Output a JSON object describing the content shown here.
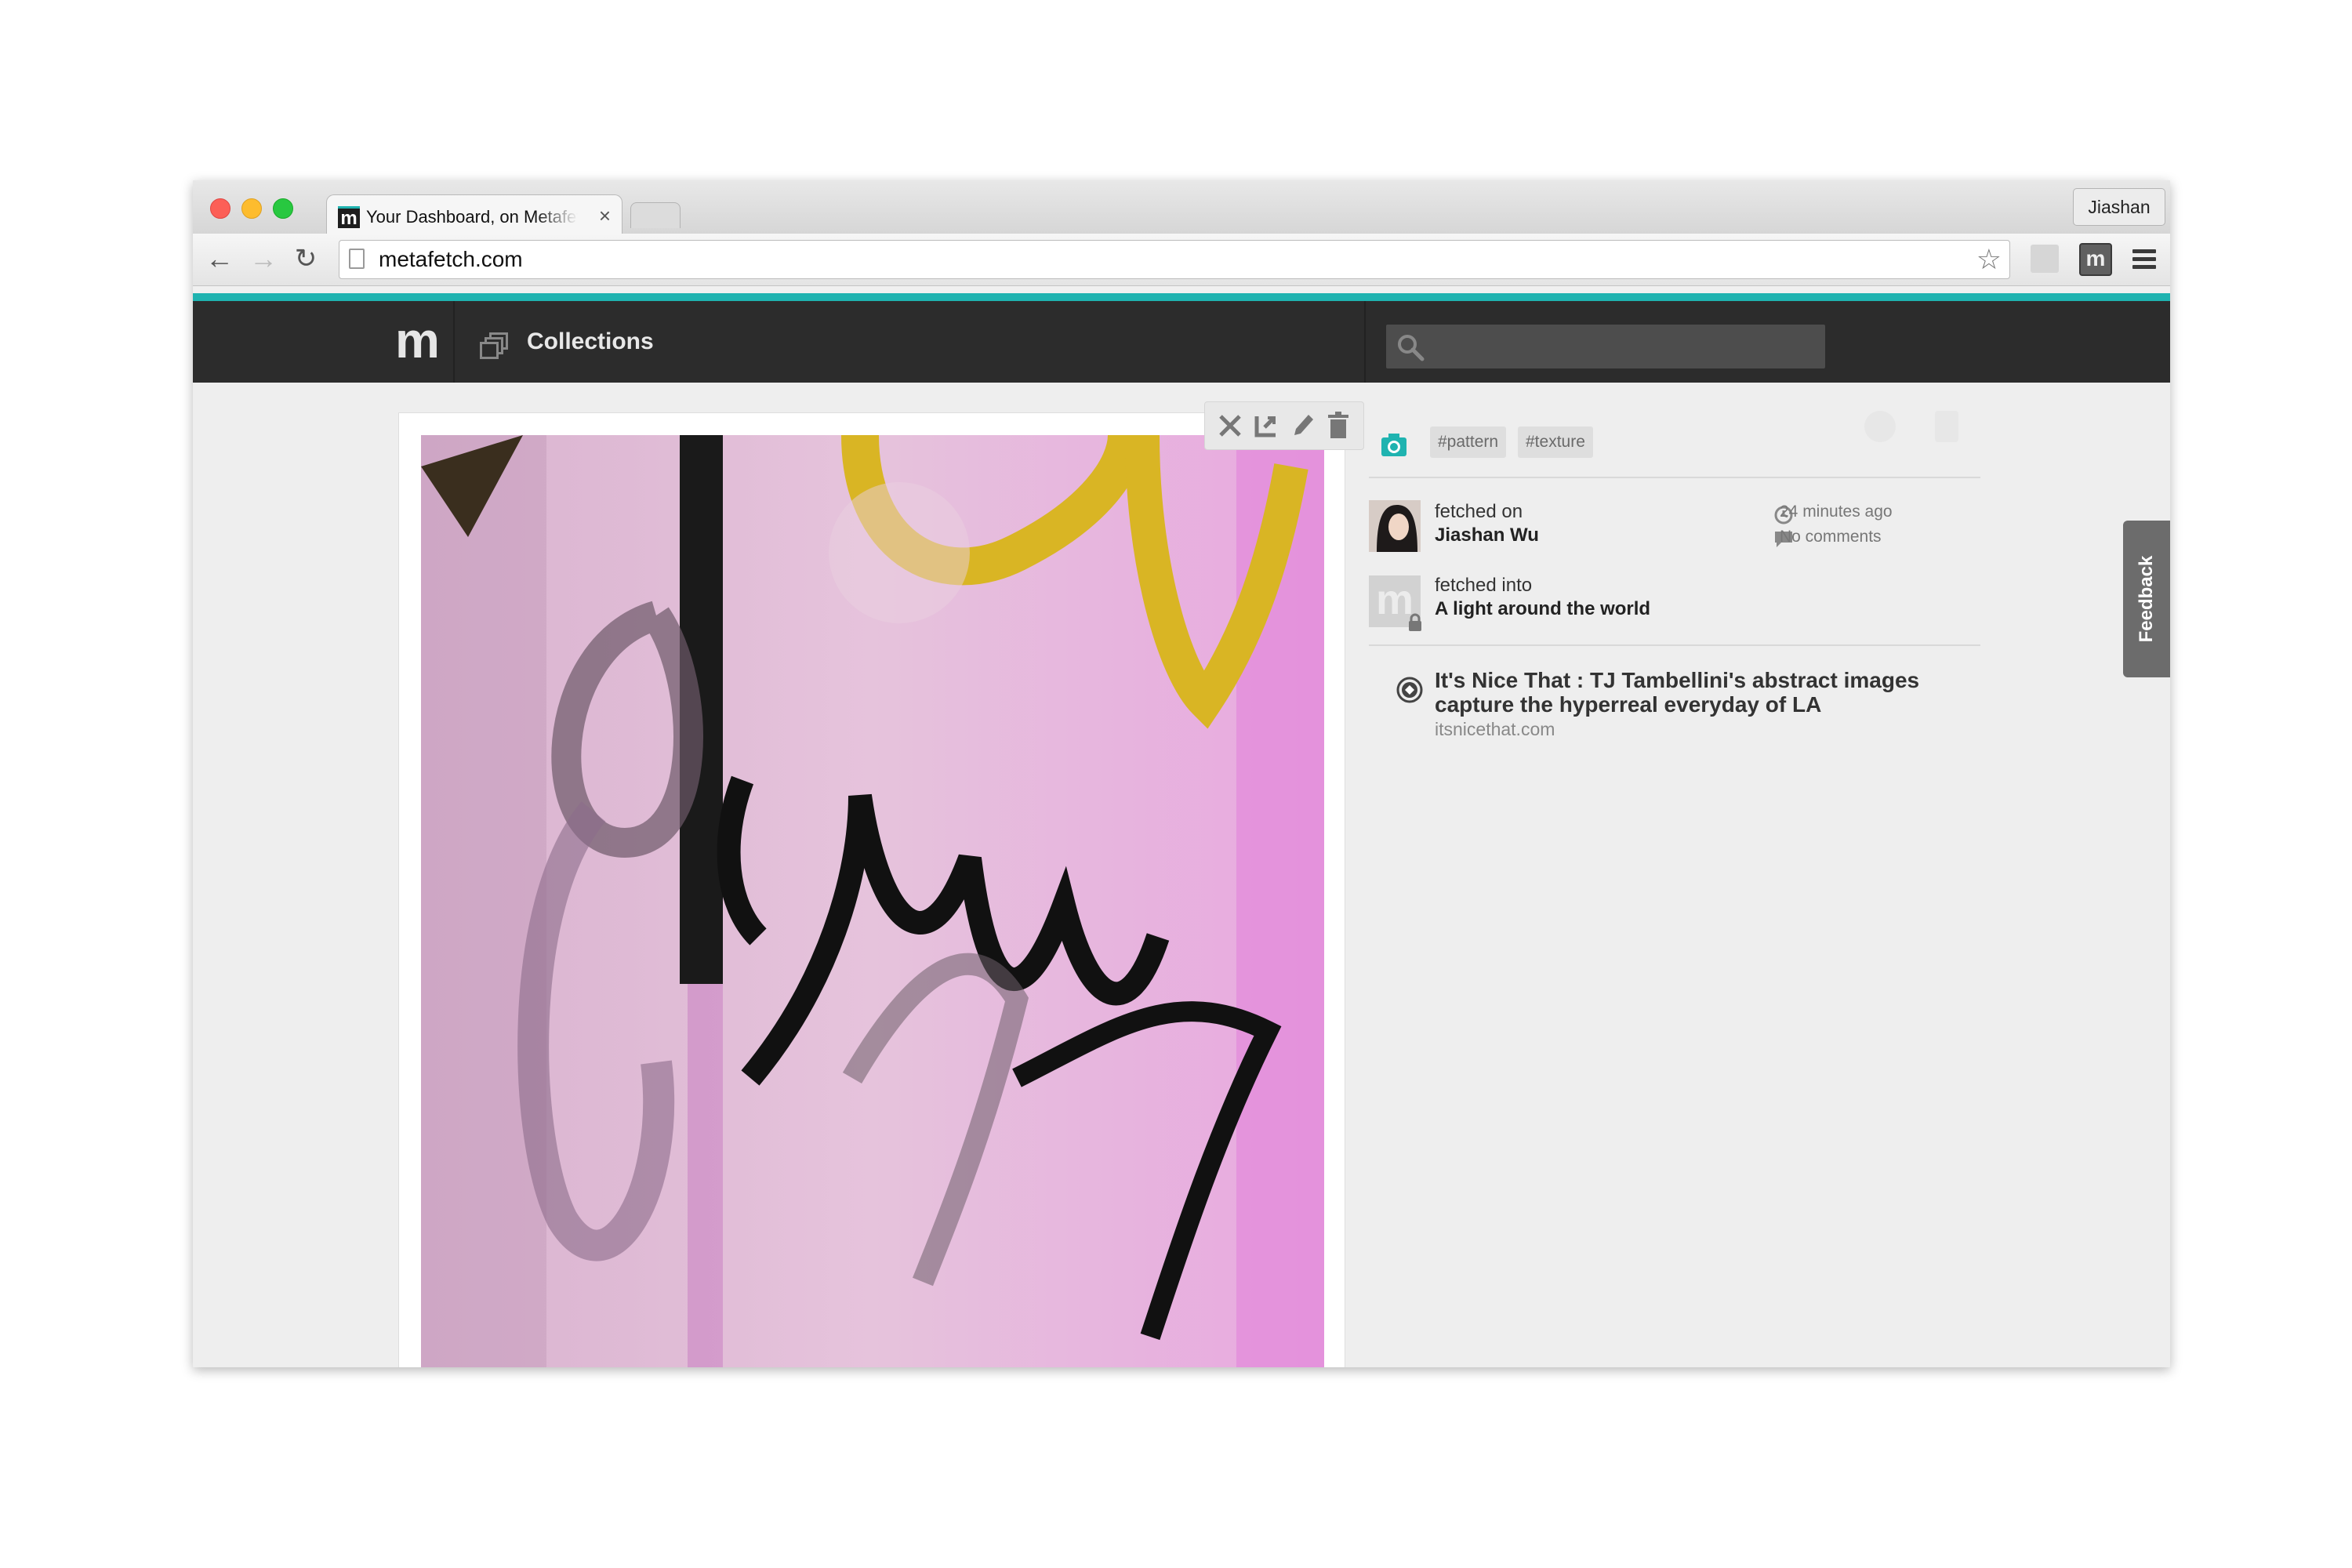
{
  "browser": {
    "tab_title": "Your Dashboard, on Metafetch",
    "tab_close": "×",
    "profile_name": "Jiashan",
    "url": "metafetch.com",
    "icons": {
      "back": "←",
      "forward": "→",
      "reload": "↻",
      "bookmark_star": "☆",
      "tab_favicon": "m",
      "extension": "m"
    }
  },
  "site": {
    "logo": "m",
    "nav": {
      "collections_label": "Collections"
    },
    "search": {
      "placeholder": ""
    },
    "colors": {
      "accent": "#1fb3b0",
      "header_bg": "#2c2c2c"
    }
  },
  "item": {
    "actions": [
      "unpin",
      "refetch",
      "edit",
      "delete"
    ],
    "tags": [
      "#pattern",
      "#texture"
    ],
    "fetched_on_label": "fetched on",
    "fetched_by": "Jiashan Wu",
    "fetched_into_label": "fetched into",
    "collection": "A light around the world",
    "collection_avatar_letter": "m",
    "time_ago": "24 minutes ago",
    "comments": "No comments",
    "source": {
      "title": "It's Nice That : TJ Tambellini's abstract images capture the hyperreal everyday of LA",
      "domain": "itsnicethat.com"
    }
  },
  "feedback_label": "Feedback"
}
